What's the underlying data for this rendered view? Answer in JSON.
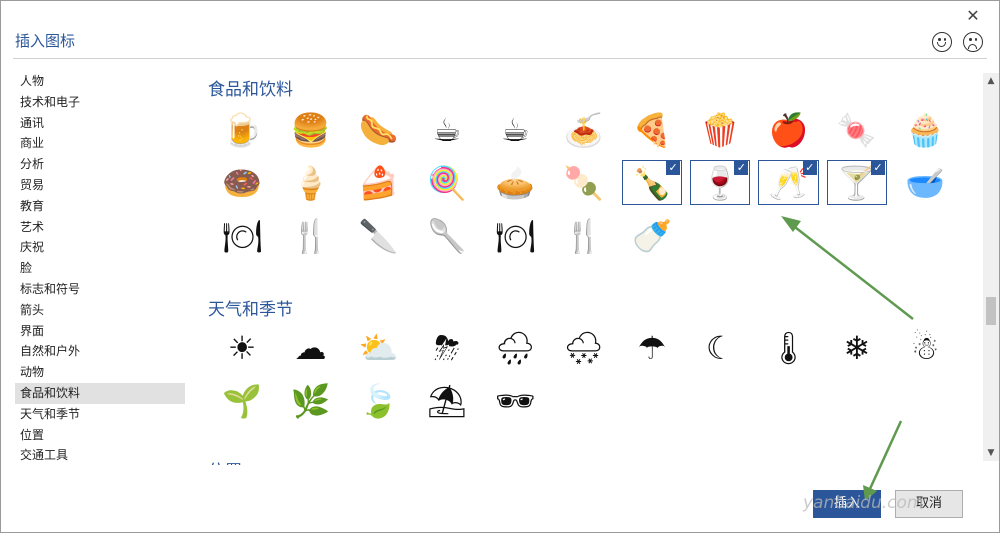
{
  "dialog": {
    "title": "插入图标",
    "close_glyph": "✕"
  },
  "feedback": {
    "smile_icon": "smile-face-icon",
    "frown_icon": "frown-face-icon"
  },
  "categories": [
    {
      "label": "人物"
    },
    {
      "label": "技术和电子"
    },
    {
      "label": "通讯"
    },
    {
      "label": "商业"
    },
    {
      "label": "分析"
    },
    {
      "label": "贸易"
    },
    {
      "label": "教育"
    },
    {
      "label": "艺术"
    },
    {
      "label": "庆祝"
    },
    {
      "label": "脸"
    },
    {
      "label": "标志和符号"
    },
    {
      "label": "箭头"
    },
    {
      "label": "界面"
    },
    {
      "label": "自然和户外"
    },
    {
      "label": "动物"
    },
    {
      "label": "食品和饮料",
      "active": true
    },
    {
      "label": "天气和季节"
    },
    {
      "label": "位置"
    },
    {
      "label": "交通工具"
    }
  ],
  "sections": [
    {
      "title": "食品和饮料",
      "icons": [
        {
          "name": "beer-mug-icon",
          "glyph": "🍺"
        },
        {
          "name": "burger-drink-icon",
          "glyph": "🍔"
        },
        {
          "name": "hotdog-icon",
          "glyph": "🌭"
        },
        {
          "name": "coffee-cup-icon",
          "glyph": "☕"
        },
        {
          "name": "hot-mug-icon",
          "glyph": "☕"
        },
        {
          "name": "spaghetti-icon",
          "glyph": "🍝"
        },
        {
          "name": "pizza-slice-icon",
          "glyph": "🍕"
        },
        {
          "name": "popcorn-icon",
          "glyph": "🍿"
        },
        {
          "name": "apple-icon",
          "glyph": "🍎"
        },
        {
          "name": "candy-icon",
          "glyph": "🍬"
        },
        {
          "name": "muffin-icon",
          "glyph": "🧁"
        },
        {
          "name": "donut-icon",
          "glyph": "🍩"
        },
        {
          "name": "ice-cream-cone-icon",
          "glyph": "🍦"
        },
        {
          "name": "cake-slice-icon",
          "glyph": "🍰"
        },
        {
          "name": "lollipop-icon",
          "glyph": "🍭"
        },
        {
          "name": "pie-icon",
          "glyph": "🥧"
        },
        {
          "name": "popsicle-icon",
          "glyph": "🍡"
        },
        {
          "name": "wine-bottle-icon",
          "glyph": "🍾",
          "selected": true
        },
        {
          "name": "wine-glass-icon",
          "glyph": "🍷",
          "selected": true
        },
        {
          "name": "champagne-flute-icon",
          "glyph": "🥂",
          "selected": true
        },
        {
          "name": "cocktail-icon",
          "glyph": "🍸",
          "selected": true
        },
        {
          "name": "bowl-icon",
          "glyph": "🥣"
        },
        {
          "name": "cloche-icon",
          "glyph": "🍽"
        },
        {
          "name": "fork-icon",
          "glyph": "🍴"
        },
        {
          "name": "knife-icon",
          "glyph": "🔪"
        },
        {
          "name": "spoon-icon",
          "glyph": "🥄"
        },
        {
          "name": "plate-icon",
          "glyph": "🍽"
        },
        {
          "name": "fork-knife-icon",
          "glyph": "🍴"
        },
        {
          "name": "baby-bottle-icon",
          "glyph": "🍼"
        }
      ]
    },
    {
      "title": "天气和季节",
      "icons": [
        {
          "name": "sun-icon",
          "glyph": "☀"
        },
        {
          "name": "cloud-icon",
          "glyph": "☁"
        },
        {
          "name": "partly-cloudy-icon",
          "glyph": "⛅"
        },
        {
          "name": "thunderstorm-icon",
          "glyph": "⛈"
        },
        {
          "name": "rain-cloud-icon",
          "glyph": "🌧"
        },
        {
          "name": "snow-cloud-icon",
          "glyph": "🌨"
        },
        {
          "name": "umbrella-icon",
          "glyph": "☂"
        },
        {
          "name": "moon-stars-icon",
          "glyph": "☾"
        },
        {
          "name": "thermometer-icon",
          "glyph": "🌡"
        },
        {
          "name": "snowflake-icon",
          "glyph": "❄"
        },
        {
          "name": "snowman-icon",
          "glyph": "☃"
        },
        {
          "name": "seed-packet-icon",
          "glyph": "🌱"
        },
        {
          "name": "sprout-icon",
          "glyph": "🌿"
        },
        {
          "name": "leaf-icon",
          "glyph": "🍃"
        },
        {
          "name": "beach-umbrella-icon",
          "glyph": "⛱"
        },
        {
          "name": "sunglasses-icon",
          "glyph": "🕶"
        }
      ]
    },
    {
      "title": "位置"
    }
  ],
  "buttons": {
    "insert": "插入",
    "cancel": "取消"
  },
  "scrollbar": {
    "up": "▲",
    "down": "▼"
  },
  "annotation_color": "#5f9a4f",
  "watermark": {
    "text": "yanbaidu.com"
  }
}
